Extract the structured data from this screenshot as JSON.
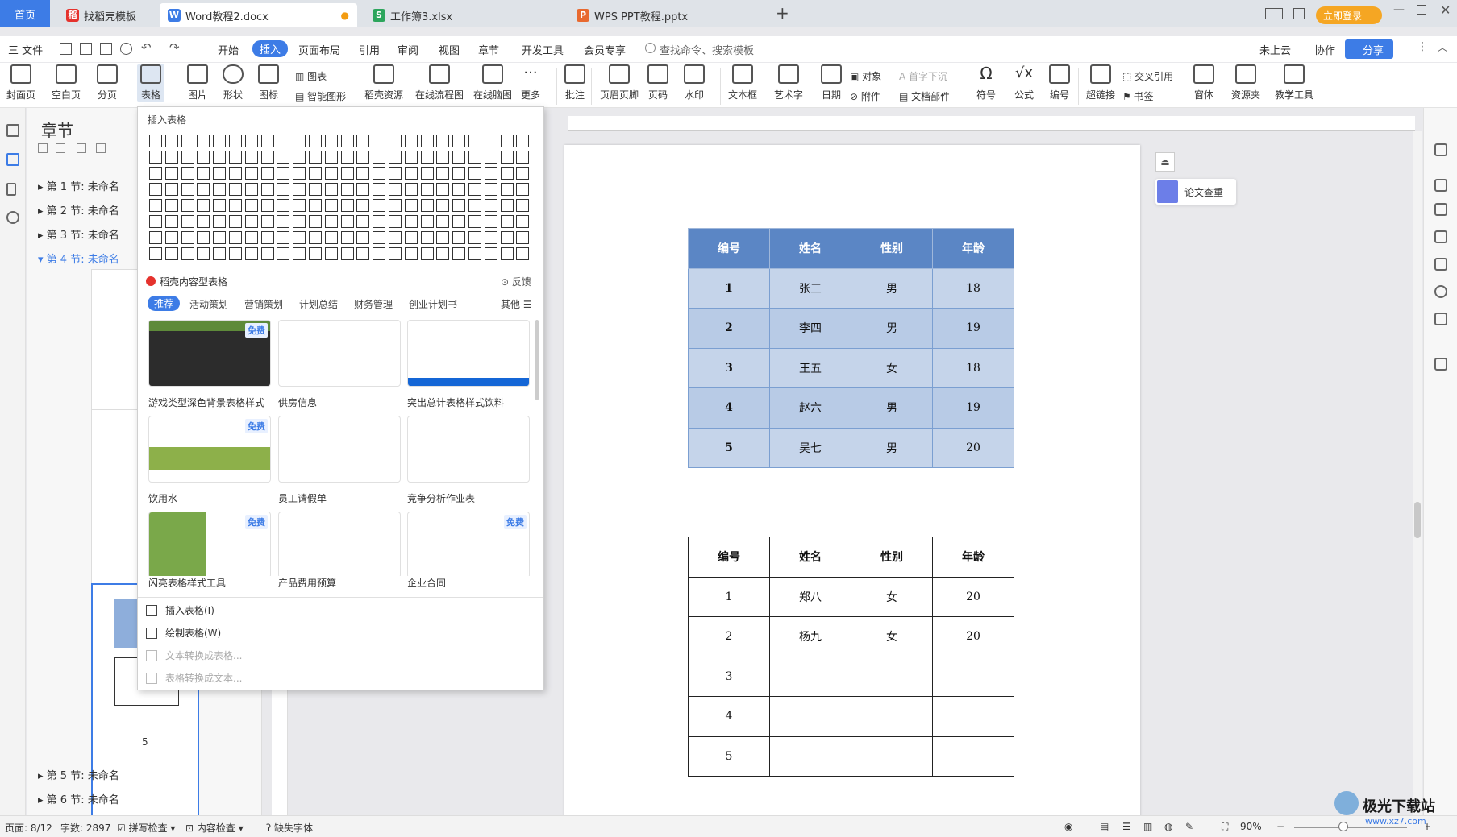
{
  "tabs": {
    "home": "首页",
    "t1": "找稻壳模板",
    "t2": "Word教程2.docx",
    "t3": "工作簿3.xlsx",
    "t4": "WPS PPT教程.pptx",
    "add": "+"
  },
  "titlebar": {
    "login": "立即登录"
  },
  "menu": {
    "file": "三 文件",
    "items": [
      "开始",
      "插入",
      "页面布局",
      "引用",
      "审阅",
      "视图",
      "章节",
      "开发工具",
      "会员专享"
    ],
    "search": "查找命令、搜索模板",
    "cloud": "未上云",
    "collab": "协作",
    "share": "分享"
  },
  "ribbon": {
    "cover": "封面页",
    "blank": "空白页",
    "break": "分页",
    "table": "表格",
    "image": "图片",
    "shape": "形状",
    "icon": "图标",
    "chart": "图表",
    "smart": "智能图形",
    "daoke": "稻壳资源",
    "flow": "在线流程图",
    "mind": "在线脑图",
    "more": "更多",
    "comment": "批注",
    "header": "页眉页脚",
    "pagenum": "页码",
    "watermark": "水印",
    "textbox": "文本框",
    "art": "艺术字",
    "date": "日期",
    "object": "对象",
    "attach": "附件",
    "dropcap": "首字下沉",
    "docpart": "文档部件",
    "symbol": "符号",
    "formula": "公式",
    "numbering": "编号",
    "hyperlink": "超链接",
    "crossref": "交叉引用",
    "bookmark": "书签",
    "form": "窗体",
    "resource": "资源夹",
    "teach": "教学工具"
  },
  "nav": {
    "title": "章节",
    "chapters": [
      "第 1 节: 未命名",
      "第 2 节: 未命名",
      "第 3 节: 未命名",
      "第 4 节: 未命名",
      "第 5 节: 未命名",
      "第 6 节: 未命名"
    ],
    "page5": "5"
  },
  "dropdown": {
    "insert_table": "插入表格",
    "daoke_title": "稻壳内容型表格",
    "feedback": "反馈",
    "categories": [
      "推荐",
      "活动策划",
      "营销策划",
      "计划总结",
      "财务管理",
      "创业计划书"
    ],
    "other": "其他",
    "free": "免费",
    "templates": [
      "游戏类型深色背景表格样式",
      "供房信息",
      "突出总计表格样式饮料",
      "饮用水",
      "员工请假单",
      "竞争分析作业表",
      "闪亮表格样式工具",
      "产品费用预算",
      "企业合同"
    ],
    "menu": [
      "插入表格(I)",
      "绘制表格(W)",
      "文本转换成表格...",
      "表格转换成文本..."
    ]
  },
  "doc": {
    "headers": [
      "编号",
      "姓名",
      "性别",
      "年龄"
    ],
    "table1": [
      [
        "1",
        "张三",
        "男",
        "18"
      ],
      [
        "2",
        "李四",
        "男",
        "19"
      ],
      [
        "3",
        "王五",
        "女",
        "18"
      ],
      [
        "4",
        "赵六",
        "男",
        "19"
      ],
      [
        "5",
        "吴七",
        "男",
        "20"
      ]
    ],
    "table2": [
      [
        "1",
        "郑八",
        "女",
        "20"
      ],
      [
        "2",
        "杨九",
        "女",
        "20"
      ],
      [
        "3",
        "",
        "",
        ""
      ],
      [
        "4",
        "",
        "",
        ""
      ],
      [
        "5",
        "",
        "",
        ""
      ]
    ]
  },
  "float": {
    "plagiarism": "论文查重"
  },
  "status": {
    "page": "页面: 8/12",
    "words": "字数: 2897",
    "spell": "拼写检查",
    "content": "内容检查",
    "font": "缺失字体",
    "zoom": "90%"
  },
  "watermark": {
    "site": "极光下载站",
    "url": "www.xz7.com"
  }
}
